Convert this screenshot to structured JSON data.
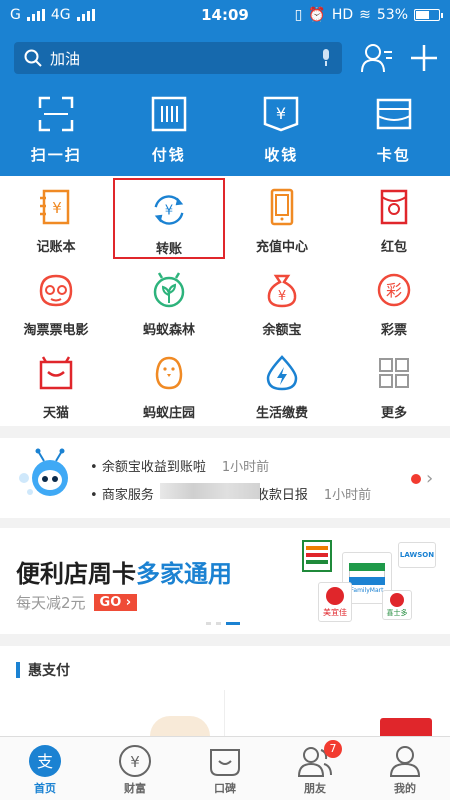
{
  "status": {
    "carrier": "G",
    "network": "4G",
    "time": "14:09",
    "hd": "HD",
    "battery": "53%"
  },
  "search": {
    "placeholder": "加油"
  },
  "quick": [
    {
      "label": "扫一扫",
      "icon": "scan-icon"
    },
    {
      "label": "付钱",
      "icon": "pay-icon"
    },
    {
      "label": "收钱",
      "icon": "receive-icon"
    },
    {
      "label": "卡包",
      "icon": "card-icon"
    }
  ],
  "grid": [
    {
      "label": "记账本",
      "icon": "ledger-icon"
    },
    {
      "label": "转账",
      "icon": "transfer-icon"
    },
    {
      "label": "充值中心",
      "icon": "recharge-icon"
    },
    {
      "label": "红包",
      "icon": "red-packet-icon"
    },
    {
      "label": "淘票票电影",
      "icon": "movie-icon"
    },
    {
      "label": "蚂蚁森林",
      "icon": "forest-icon"
    },
    {
      "label": "余额宝",
      "icon": "yuebao-icon"
    },
    {
      "label": "彩票",
      "icon": "lottery-icon"
    },
    {
      "label": "天猫",
      "icon": "tmall-icon"
    },
    {
      "label": "蚂蚁庄园",
      "icon": "chick-icon"
    },
    {
      "label": "生活缴费",
      "icon": "utility-icon"
    },
    {
      "label": "更多",
      "icon": "more-icon"
    }
  ],
  "news": [
    {
      "text": "余额宝收益到账啦",
      "time": "1小时前"
    },
    {
      "text_pre": "商家服务",
      "text_post": "收款日报",
      "time": "1小时前"
    }
  ],
  "banner": {
    "title_a": "便利店周卡",
    "title_b": "多家通用",
    "sub": "每天减2元",
    "go": "GO",
    "stores": [
      "LAWSON",
      "FamilyMart",
      "美宜佳",
      "喜士多"
    ]
  },
  "section": {
    "title": "惠支付"
  },
  "tabs": [
    {
      "label": "首页",
      "icon": "home-icon",
      "active": true
    },
    {
      "label": "财富",
      "icon": "wealth-icon"
    },
    {
      "label": "口碑",
      "icon": "koubei-icon"
    },
    {
      "label": "朋友",
      "icon": "friends-icon",
      "badge": "7"
    },
    {
      "label": "我的",
      "icon": "profile-icon"
    }
  ],
  "colors": {
    "brand": "#1b82d2",
    "orange": "#f08a24",
    "red": "#e0262b"
  }
}
